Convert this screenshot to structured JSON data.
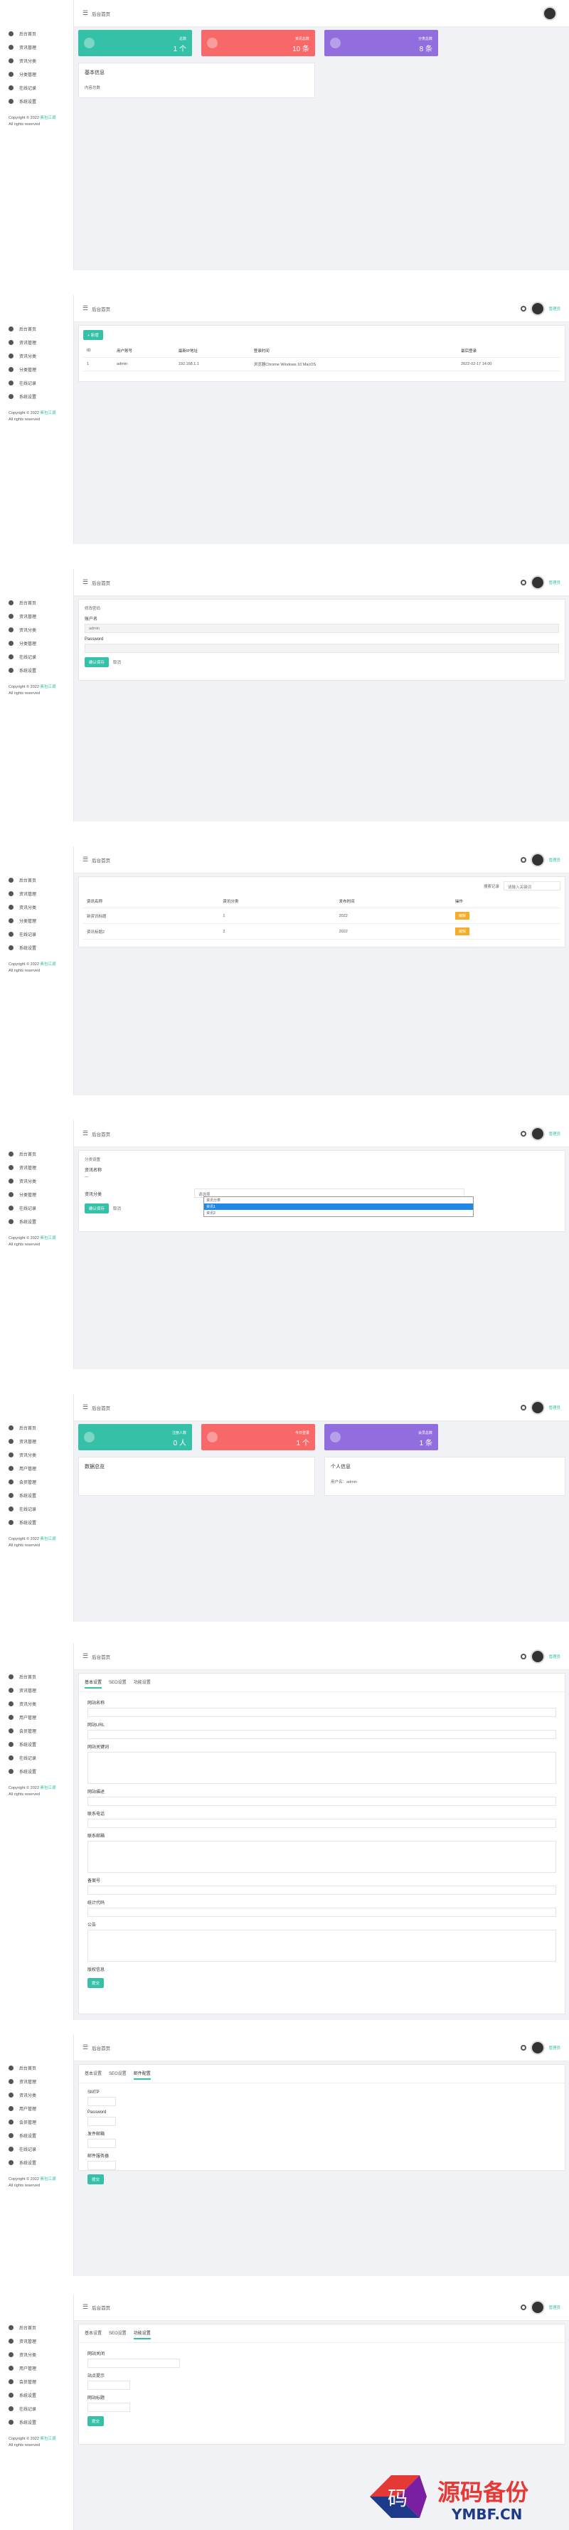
{
  "brand": {
    "title": "后台首页",
    "user": "管理员",
    "copyright": "Copyright © 2022",
    "copyright_link": "素包江湖",
    "rights": "All rights reserved"
  },
  "nav_short": [
    "后台首页",
    "资讯管理",
    "资讯分类",
    "分类管理",
    "在线记录",
    "在线记录",
    "系统设置"
  ],
  "nav_long": [
    "后台首页",
    "资讯管理",
    "资讯分类",
    "用户管理",
    "会员管理",
    "系统设置",
    "在线记录",
    "系统设置"
  ],
  "screen1": {
    "stats": [
      {
        "label": "总数",
        "value": "1 个"
      },
      {
        "label": "资讯总数",
        "value": "10 条"
      },
      {
        "label": "分类总数",
        "value": "8 条"
      }
    ],
    "panel_title": "基本信息",
    "panel_text": "内容总数"
  },
  "screen2": {
    "add_button": "+ 新增",
    "headers": [
      "ID",
      "用户账号",
      "最新IP地址",
      "登录时间",
      "",
      "最后登录"
    ],
    "row": [
      "1",
      "admin",
      "192.168.1.1",
      "浏览器Chrome Windows 10 MacOS",
      "",
      "2022-02-17 14:00"
    ]
  },
  "screen3": {
    "tab": "修改密码",
    "labels": [
      "账户名",
      "Password"
    ],
    "values": [
      "admin",
      ""
    ],
    "save": "确认保存",
    "reset": "取消"
  },
  "screen4": {
    "search_btn": "搜索记录",
    "search_placeholder": "请输入关键词",
    "headers": [
      "资讯名称",
      "资讯分类",
      "发布时间",
      "操作"
    ],
    "rows": [
      [
        "新资讯标题",
        "1",
        "2022",
        "编辑"
      ],
      [
        "资讯标题2",
        "2",
        "2022",
        "编辑"
      ]
    ]
  },
  "screen5": {
    "tab": "分类设置",
    "field1": "资讯名称",
    "field2": "资讯分类",
    "select_value": "请选择",
    "options": [
      "资讯分类",
      "资讯1",
      "资讯2"
    ],
    "save": "确认保存",
    "reset": "取消"
  },
  "screen6": {
    "stats": [
      {
        "label": "注册人数",
        "value": "0 人"
      },
      {
        "label": "今日登录",
        "value": "1 个"
      },
      {
        "label": "会员总数",
        "value": "1 条"
      }
    ],
    "left_title": "数据总览",
    "right_title": "个人信息",
    "right_text": "用户名：admin"
  },
  "screen7": {
    "tabs": [
      "基本设置",
      "SEO设置",
      "功能设置"
    ],
    "fields": [
      "网站名称",
      "网站URL",
      "网站关键词",
      "网站描述",
      "联系电话",
      "联系邮箱",
      "备案号",
      "统计代码",
      "公告",
      "版权信息"
    ],
    "save": "提交"
  },
  "screen8": {
    "tabs": [
      "基本设置",
      "SEO设置",
      "邮件配置"
    ],
    "fields": [
      "SMTP",
      "Password",
      "发件邮箱",
      "邮件服务器"
    ],
    "save": "提交"
  },
  "screen9": {
    "tabs": [
      "基本设置",
      "SEO设置",
      "功能设置"
    ],
    "fields": [
      "网站关闭",
      "站点提示",
      "网站标题"
    ],
    "save": "提交"
  },
  "watermark": {
    "brand": "源码备份",
    "url": "YMBF.CN",
    "sub": "码"
  }
}
